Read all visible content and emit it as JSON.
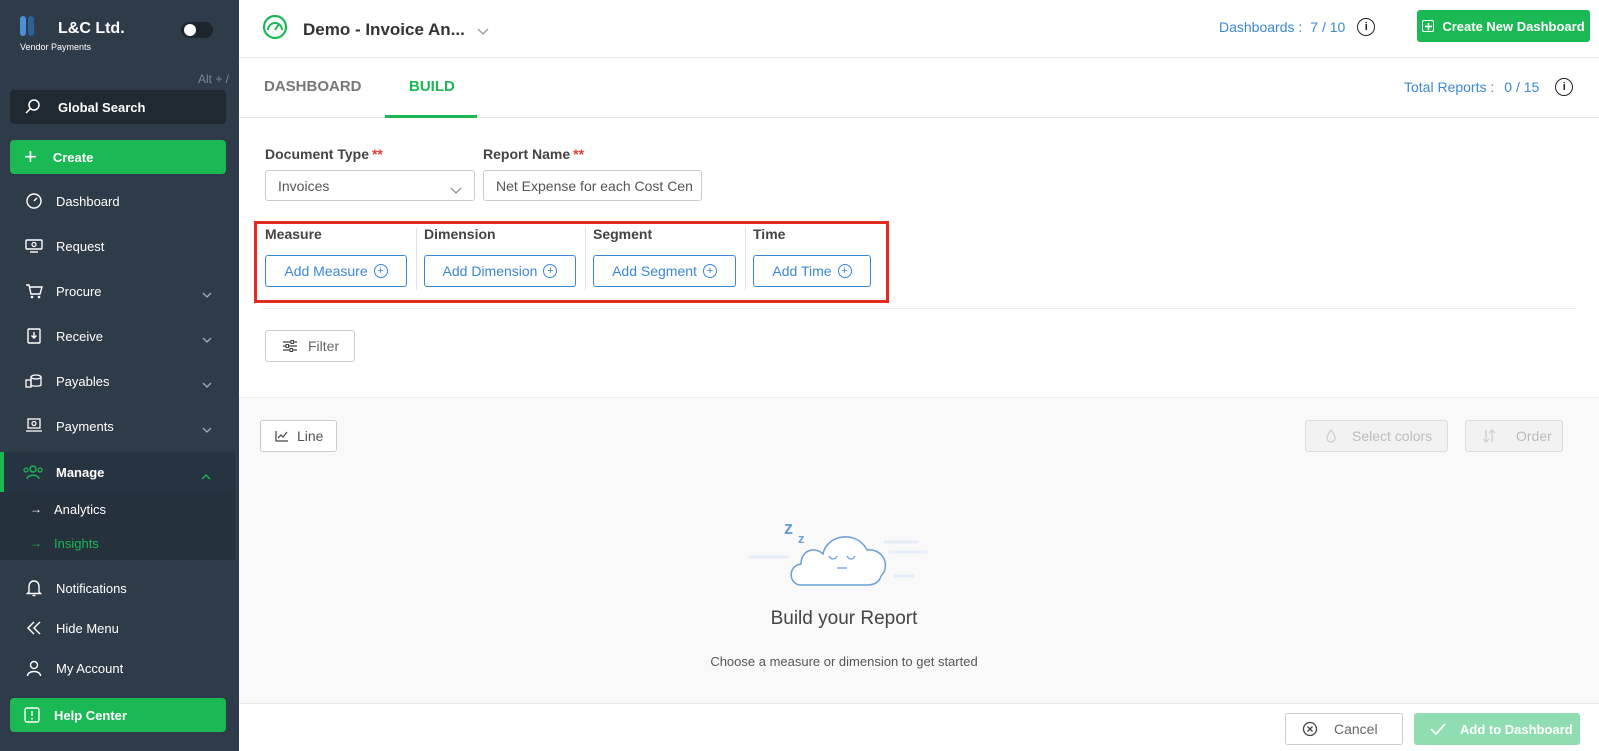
{
  "sidebar": {
    "brand_name": "L&C Ltd.",
    "brand_sub": "Vendor Payments",
    "alt_hint": "Alt + /",
    "global_search": "Global Search",
    "create": "Create",
    "items": [
      {
        "label": "Dashboard",
        "icon": "dashboard-icon"
      },
      {
        "label": "Request",
        "icon": "request-icon"
      },
      {
        "label": "Procure",
        "icon": "cart-icon"
      },
      {
        "label": "Receive",
        "icon": "receive-icon"
      },
      {
        "label": "Payables",
        "icon": "coins-icon"
      },
      {
        "label": "Payments",
        "icon": "payments-icon"
      }
    ],
    "manage": "Manage",
    "sub_items": [
      {
        "label": "Analytics"
      },
      {
        "label": "Insights"
      }
    ],
    "notifications": "Notifications",
    "hide_menu": "Hide Menu",
    "my_account": "My Account",
    "help_center": "Help Center"
  },
  "header": {
    "dashboard_title": "Demo - Invoice An...",
    "dashboards_label": "Dashboards :",
    "dashboards_value": "7 / 10",
    "create_new_dashboard": "Create New Dashboard"
  },
  "tabs": {
    "dashboard": "DASHBOARD",
    "build": "BUILD",
    "total_reports_label": "Total Reports :",
    "total_reports_value": "0  /  15"
  },
  "form": {
    "document_type_label": "Document Type",
    "document_type_value": "Invoices",
    "report_name_label": "Report Name",
    "report_name_value": "Net Expense for each Cost Cen",
    "required_mark": "**"
  },
  "builder": {
    "measure_label": "Measure",
    "measure_button": "Add Measure",
    "dimension_label": "Dimension",
    "dimension_button": "Add Dimension",
    "segment_label": "Segment",
    "segment_button": "Add Segment",
    "time_label": "Time",
    "time_button": "Add Time",
    "filter": "Filter"
  },
  "preview": {
    "chart_type": "Line",
    "select_colors": "Select colors",
    "order": "Order",
    "empty_title": "Build your Report",
    "empty_sub": "Choose a measure or dimension to get started"
  },
  "footer": {
    "cancel": "Cancel",
    "add_to_dashboard": "Add to Dashboard"
  },
  "colors": {
    "sidebar_bg": "#2e3b48",
    "accent_green": "#1bb954",
    "link_blue": "#3a87d6",
    "highlight_red": "#e32b22"
  }
}
